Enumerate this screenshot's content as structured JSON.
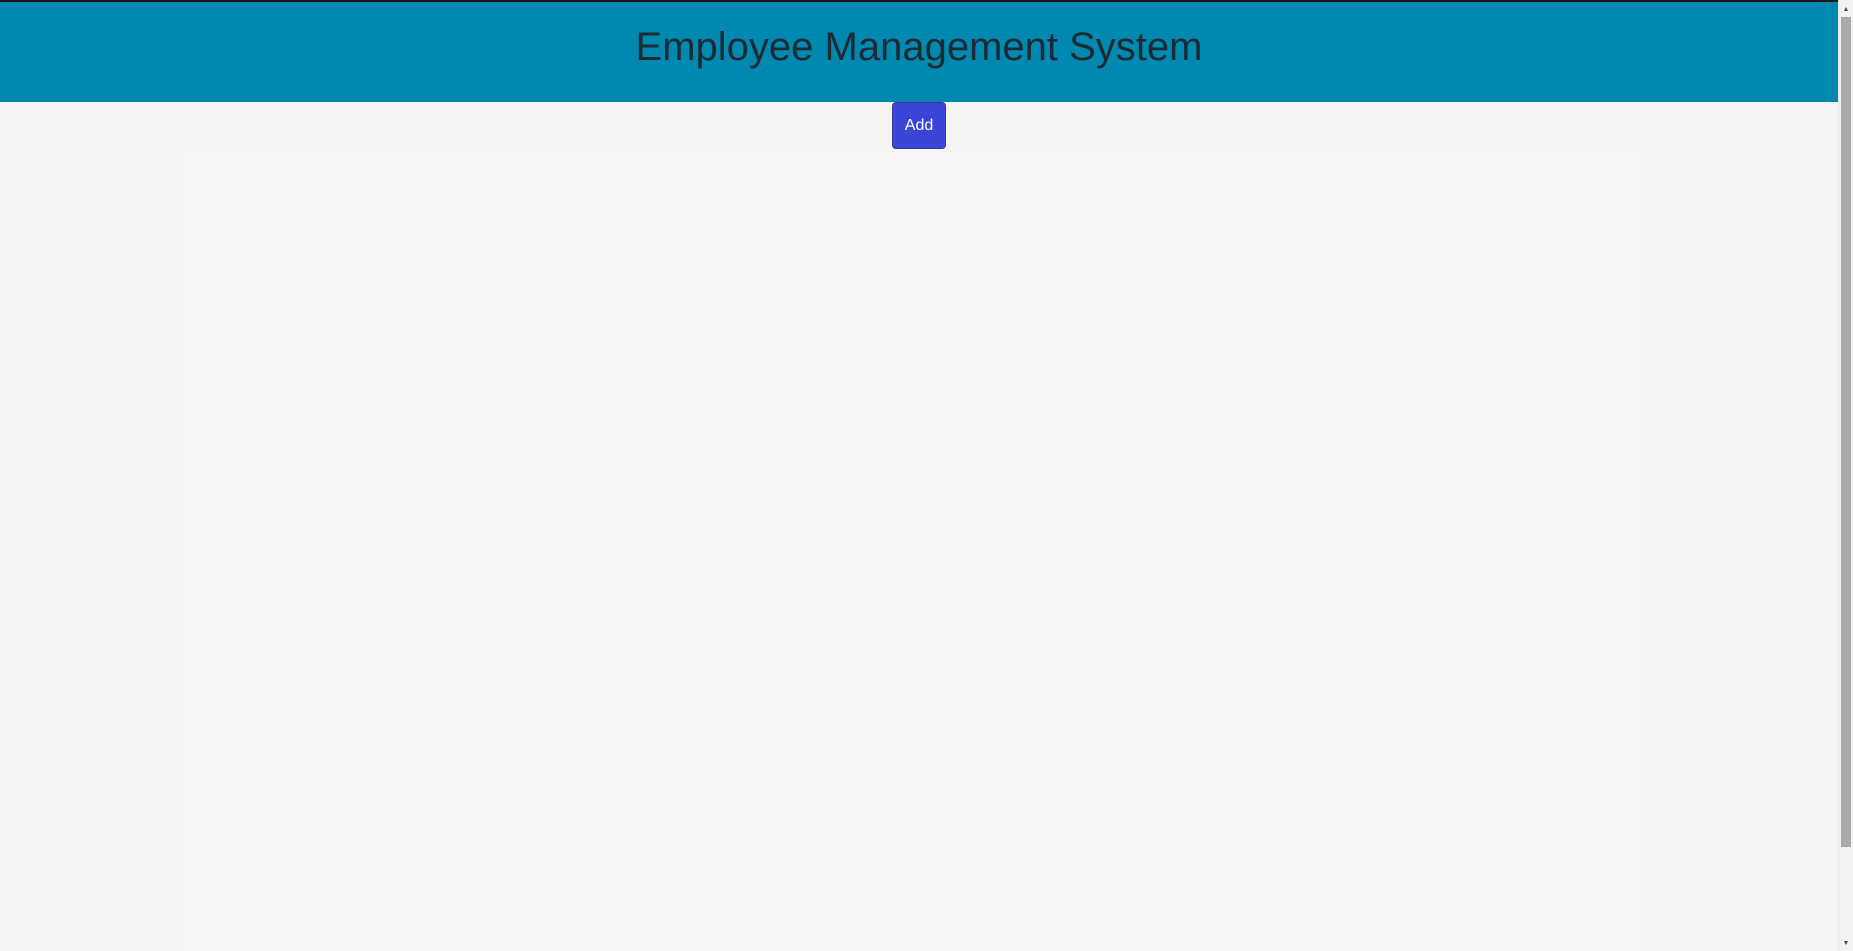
{
  "header": {
    "title": "Employee Management System"
  },
  "toolbar": {
    "add_label": "Add"
  },
  "scrollbar": {
    "up_icon": "▲",
    "down_icon": "▼"
  },
  "colors": {
    "header_bg": "#0089b0",
    "add_button_bg": "#3b46d9",
    "page_bg": "#f5f4f3",
    "panel_bg": "#f3f6f4"
  }
}
